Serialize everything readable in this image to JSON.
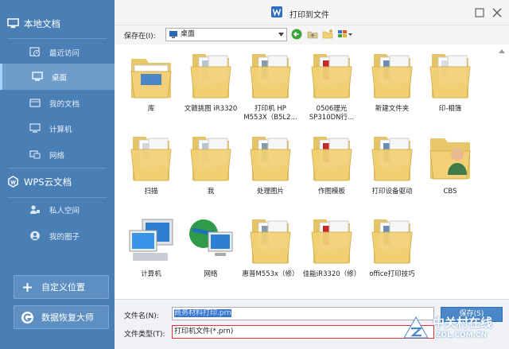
{
  "sidebar": {
    "local_title": "本地文档",
    "items": [
      {
        "label": "最近访问",
        "icon": "clock-icon"
      },
      {
        "label": "桌面",
        "icon": "desktop-icon"
      },
      {
        "label": "我的文档",
        "icon": "documents-icon"
      },
      {
        "label": "计算机",
        "icon": "computer-icon"
      },
      {
        "label": "网络",
        "icon": "network-icon"
      }
    ],
    "cloud_title": "WPS云文档",
    "cloud_items": [
      {
        "label": "私人空间",
        "icon": "user-lock-icon"
      },
      {
        "label": "我的圈子",
        "icon": "circle-user-icon"
      }
    ],
    "custom_location": "自定义位置",
    "data_recovery": "数据恢复大师"
  },
  "window": {
    "title": "打印到文件"
  },
  "toolbar": {
    "save_in_label": "保存在(I):",
    "location": "桌面"
  },
  "files": [
    {
      "label": "库",
      "kind": "library"
    },
    {
      "label": "文赣挑图 iR3320",
      "kind": "folder"
    },
    {
      "label": "打印机  HP",
      "label2": "M553X（B5L2...",
      "kind": "folder"
    },
    {
      "label": "0506理光",
      "label2": "SP310DN行...",
      "kind": "folder"
    },
    {
      "label": "新建文件夹",
      "kind": "folder"
    },
    {
      "label": "印-相簿",
      "kind": "folder"
    },
    {
      "label": "扫描",
      "kind": "folder"
    },
    {
      "label": "我",
      "kind": "folder"
    },
    {
      "label": "处理图片",
      "kind": "folder"
    },
    {
      "label": "作图模板",
      "kind": "folder"
    },
    {
      "label": "打印设备驱动",
      "kind": "folder"
    },
    {
      "label": "CBS",
      "kind": "user"
    },
    {
      "label": "计算机",
      "kind": "computer"
    },
    {
      "label": "网络",
      "kind": "network"
    },
    {
      "label": "惠普M553x（修）",
      "kind": "folder"
    },
    {
      "label": "佳能iR3320（修）",
      "kind": "folder"
    },
    {
      "label": "office打印技巧",
      "kind": "folder"
    }
  ],
  "bottom": {
    "filename_label": "文件名(N):",
    "filename_value": "商务材料打印.prn",
    "filetype_label": "文件类型(T):",
    "filetype_value": "打印机文件(*.prn)",
    "save_button": "保存(S)"
  },
  "watermark": {
    "cn": "中关村在线",
    "en": "ZOL.COM.CN"
  },
  "colors": {
    "sidebar": "#4a7fb5",
    "accent": "#3b78d1",
    "folder": "#f2d176"
  }
}
